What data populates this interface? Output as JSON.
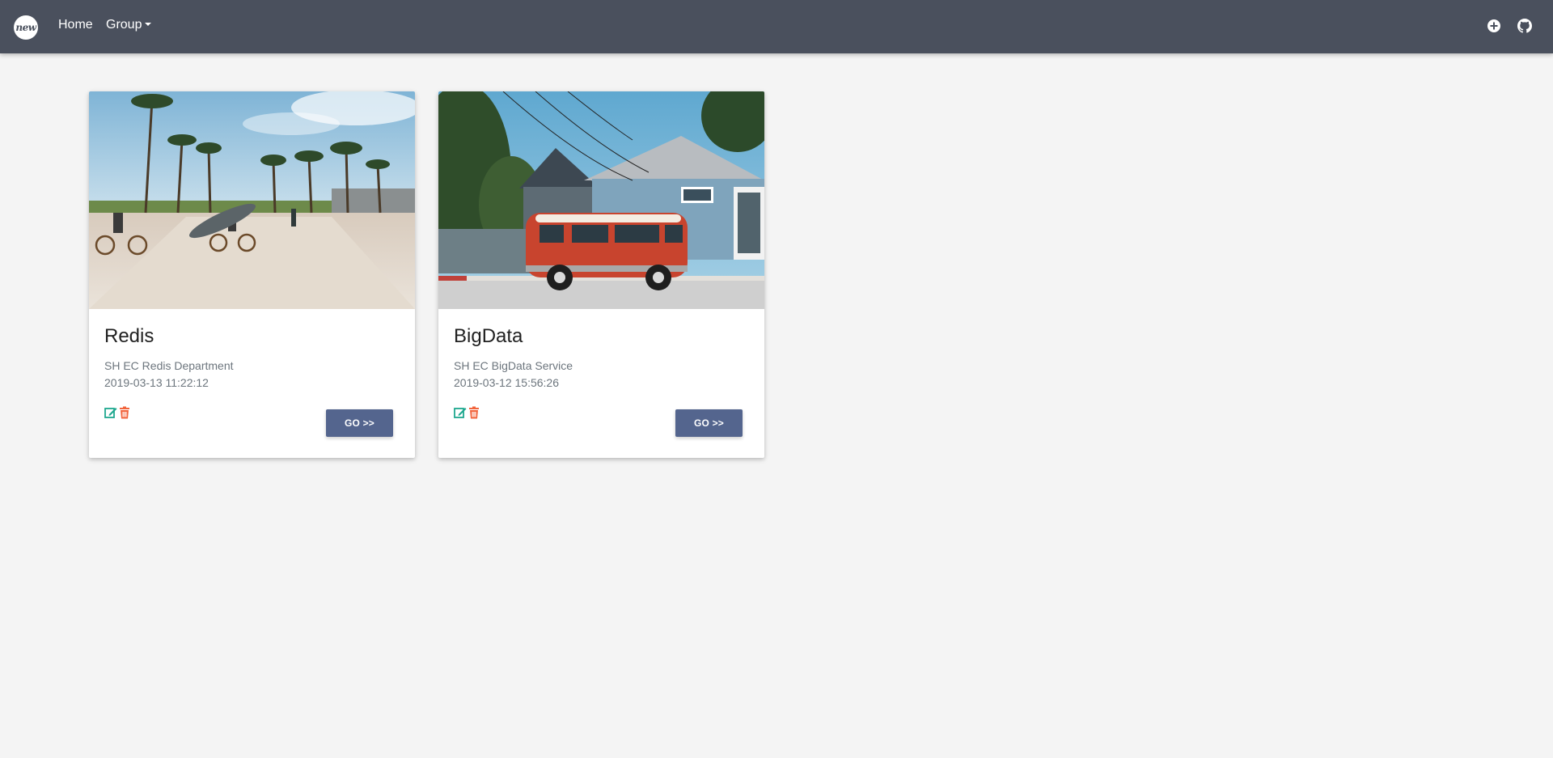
{
  "navbar": {
    "logo_text": "new",
    "home_label": "Home",
    "group_label": "Group",
    "icons": [
      "plus-circle-icon",
      "github-icon"
    ],
    "background": "#4a505d"
  },
  "cards": [
    {
      "title": "Redis",
      "description": "SH EC Redis Department",
      "date": "2019-03-13 11:22:12",
      "image": "beach-boardwalk-photo",
      "go_label": "GO >>"
    },
    {
      "title": "BigData",
      "description": "SH EC BigData Service",
      "date": "2019-03-12 15:56:26",
      "image": "red-van-house-photo",
      "go_label": "GO >>"
    }
  ],
  "colors": {
    "button": "#54658e",
    "edit_icon": "#1fa88f",
    "delete_icon": "#f2643c",
    "page_background": "#f4f4f4"
  }
}
